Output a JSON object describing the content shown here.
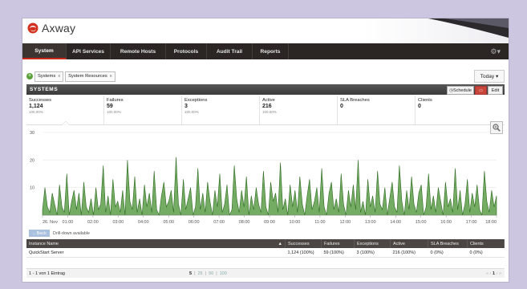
{
  "app": {
    "name": "Axway"
  },
  "nav": {
    "items": [
      "System",
      "API Services",
      "Remote Hosts",
      "Protocols",
      "Audit Trail",
      "Reports"
    ]
  },
  "tabs": [
    {
      "label": "Systems"
    },
    {
      "label": "System Resources"
    }
  ],
  "tab_close": "x",
  "today": {
    "label": "Today"
  },
  "panel": {
    "title": "SYSTEMS",
    "schedule_label": "Schedule",
    "edit_label": "Edit"
  },
  "stats": [
    {
      "label": "Successes",
      "value": "1,124",
      "pct": "100.00%"
    },
    {
      "label": "Failures",
      "value": "59",
      "pct": "100.00%"
    },
    {
      "label": "Exceptions",
      "value": "3",
      "pct": "100.00%"
    },
    {
      "label": "Active",
      "value": "216",
      "pct": "100.00%"
    },
    {
      "label": "SLA Breaches",
      "value": "0",
      "pct": ""
    },
    {
      "label": "Clients",
      "value": "0",
      "pct": ""
    }
  ],
  "chart_data": {
    "type": "area",
    "x_ticks": [
      "26. Nov",
      "01:00",
      "02:00",
      "03:00",
      "04:00",
      "05:00",
      "06:00",
      "07:00",
      "08:00",
      "09:00",
      "10:00",
      "11:00",
      "12:00",
      "13:00",
      "14:00",
      "15:00",
      "16:00",
      "17:00",
      "18:00"
    ],
    "y_ticks": [
      10,
      20,
      30
    ],
    "ylim": [
      0,
      32
    ],
    "series": [
      {
        "values": [
          2,
          10,
          3,
          1,
          8,
          4,
          0,
          11,
          3,
          1,
          15,
          0,
          5,
          9,
          2,
          8,
          0,
          12,
          3,
          1,
          6,
          0,
          10,
          2,
          4,
          18,
          1,
          7,
          0,
          13,
          3,
          5,
          1,
          9,
          0,
          20,
          5,
          2,
          14,
          1,
          6,
          0,
          11,
          3,
          8,
          1,
          16,
          2,
          0,
          7,
          12,
          3,
          5,
          9,
          1,
          21,
          4,
          0,
          13,
          2,
          6,
          10,
          0,
          3,
          17,
          2,
          8,
          1,
          12,
          5,
          0,
          9,
          3,
          15,
          1,
          4,
          11,
          0,
          2,
          18,
          6,
          1,
          9,
          3,
          14,
          0,
          7,
          2,
          10,
          4,
          1,
          16,
          3,
          0,
          12,
          5,
          8,
          1,
          19,
          2,
          6,
          0,
          11,
          3,
          9,
          1,
          14,
          4,
          0,
          7,
          13,
          2,
          5,
          10,
          1,
          17,
          3,
          0,
          8,
          12,
          2,
          6,
          1,
          15,
          4,
          0,
          9,
          3,
          11,
          2,
          20,
          1,
          5,
          0,
          13,
          3,
          7,
          1,
          16,
          4,
          2,
          10,
          0,
          6,
          12,
          3,
          1,
          18,
          5,
          0,
          9,
          2,
          14,
          4,
          1,
          8,
          11,
          0,
          3,
          15,
          2,
          7,
          1,
          10,
          5,
          0,
          12,
          3,
          6,
          1,
          17,
          2,
          9,
          0,
          4,
          13,
          1,
          8,
          3,
          11,
          2,
          0,
          16,
          5,
          1,
          9,
          3,
          7
        ]
      }
    ],
    "color": "#5a9e46"
  },
  "back": {
    "label": "Back"
  },
  "drill": {
    "text": "Drill-down available"
  },
  "table": {
    "headers": [
      "Instance Name",
      "Successes",
      "Failures",
      "Exceptions",
      "Active",
      "SLA Breaches",
      "Clients"
    ],
    "rows": [
      [
        "QuickStart Server",
        "1,124 (100%)",
        "59 (100%)",
        "3 (100%)",
        "216 (100%)",
        "0 (0%)",
        "0 (0%)"
      ]
    ]
  },
  "pager": {
    "info": "1 - 1 von 1 Eintrag",
    "sizes": [
      "5",
      "25",
      "50",
      "100"
    ],
    "sep": "|",
    "current_page": "1"
  }
}
